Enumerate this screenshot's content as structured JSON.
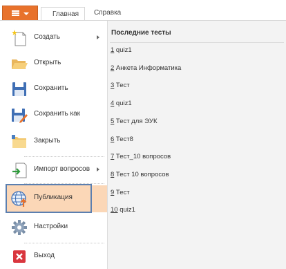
{
  "ribbon": {
    "tabs": [
      "Главная",
      "Справка"
    ]
  },
  "menu": {
    "items": [
      {
        "label": "Создать",
        "icon": "new-document-icon",
        "has_submenu": true
      },
      {
        "label": "Открыть",
        "icon": "open-folder-icon",
        "has_submenu": false
      },
      {
        "label": "Сохранить",
        "icon": "floppy-disk-icon",
        "has_submenu": false
      },
      {
        "label": "Сохранить как",
        "icon": "save-as-icon",
        "has_submenu": false
      },
      {
        "label": "Закрыть",
        "icon": "close-folder-icon",
        "has_submenu": false
      },
      {
        "label": "Импорт вопросов",
        "icon": "import-icon",
        "has_submenu": true
      },
      {
        "label": "Публикация",
        "icon": "globe-upload-icon",
        "has_submenu": false,
        "selected": true
      },
      {
        "label": "Настройки",
        "icon": "gear-icon",
        "has_submenu": false
      },
      {
        "label": "Выход",
        "icon": "exit-icon",
        "has_submenu": false
      }
    ]
  },
  "recent": {
    "title": "Последние тесты",
    "items": [
      {
        "num": "1",
        "name": "quiz1"
      },
      {
        "num": "2",
        "name": "Анкета Информатика"
      },
      {
        "num": "3",
        "name": "Тест"
      },
      {
        "num": "4",
        "name": "quiz1"
      },
      {
        "num": "5",
        "name": "Тест для ЭУК"
      },
      {
        "num": "6",
        "name": "Тест8"
      },
      {
        "num": "7",
        "name": "Тест_10 вопросов"
      },
      {
        "num": "8",
        "name": "Тест 10 вопросов"
      },
      {
        "num": "9",
        "name": "Тест"
      },
      {
        "num": "10",
        "name": "quiz1"
      }
    ]
  },
  "colors": {
    "file_button": "#e8722c",
    "selected_item": "#fbd7b7",
    "highlight_frame": "#5b7fb0",
    "recent_pane": "#f3f3f3"
  }
}
